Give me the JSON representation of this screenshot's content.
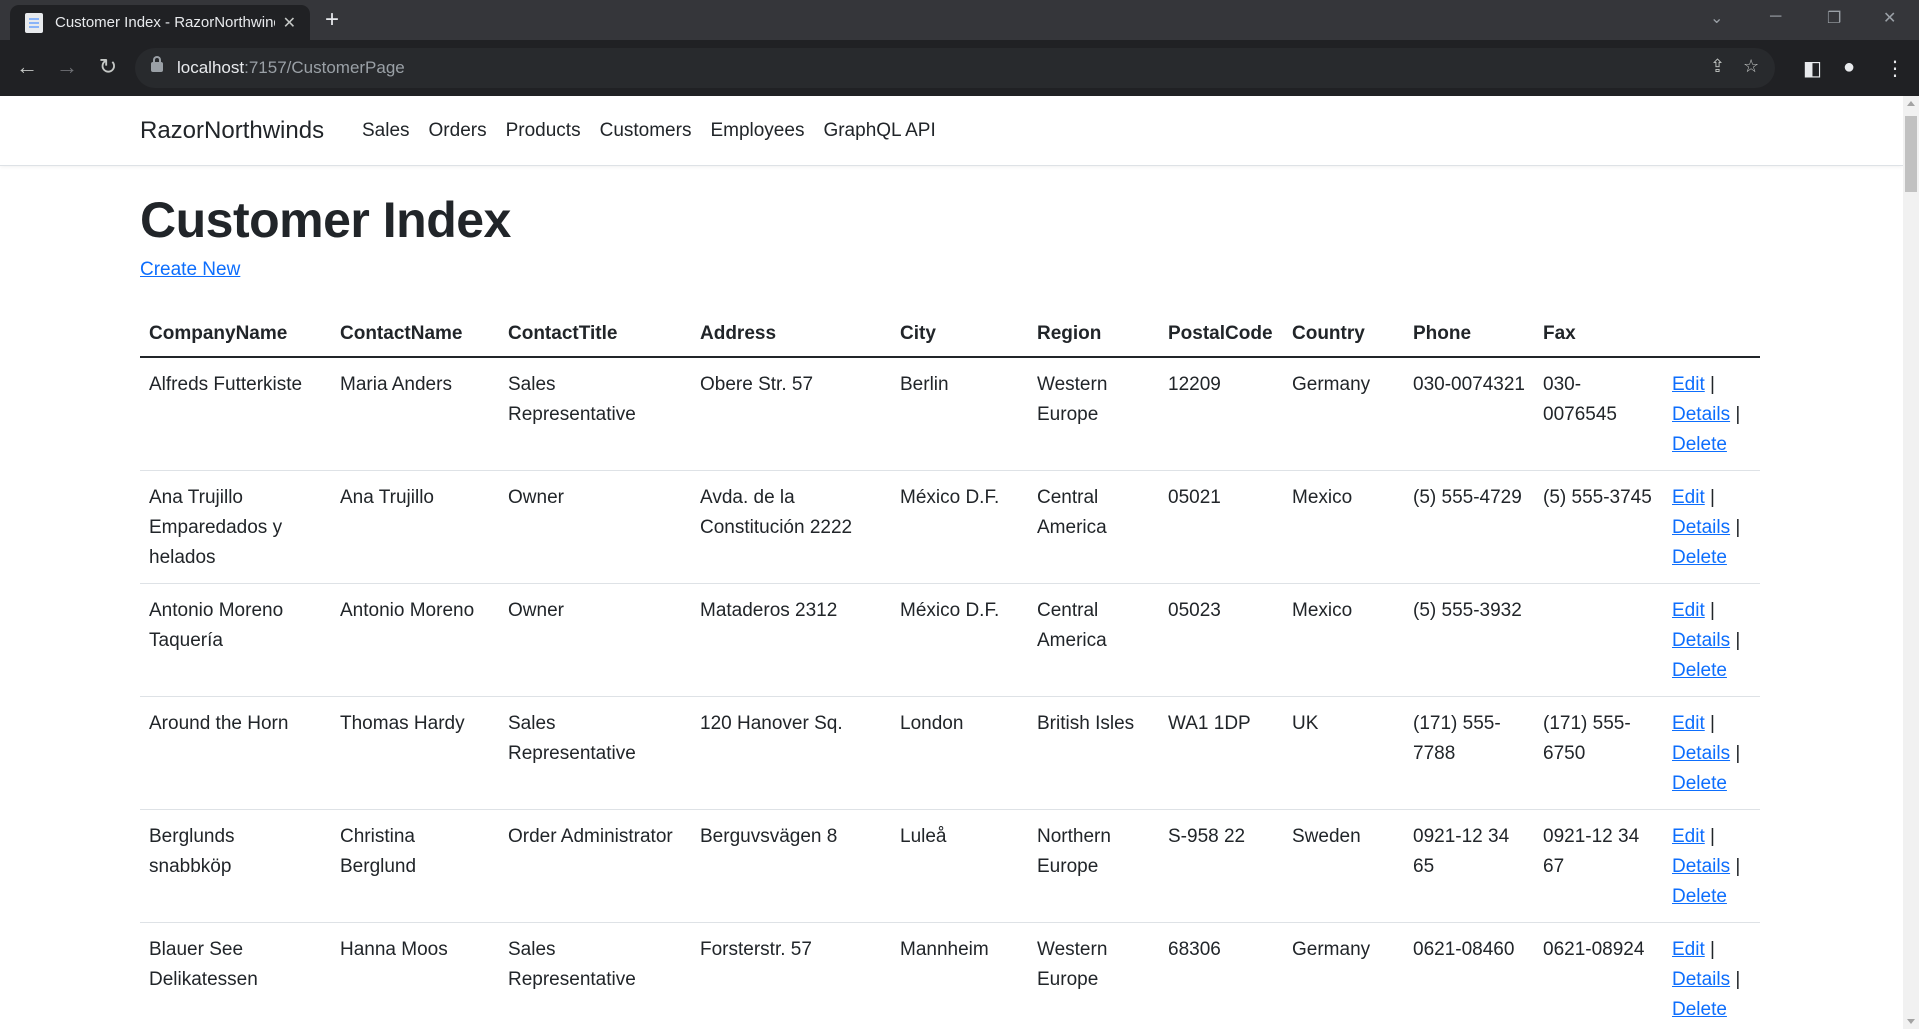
{
  "browser": {
    "tab_title": "Customer Index - RazorNorthwinds",
    "url_host": "localhost",
    "url_rest": ":7157/CustomerPage",
    "new_tab_glyph": "+",
    "close_glyph": "✕"
  },
  "navbar": {
    "brand": "RazorNorthwinds",
    "links": [
      "Sales",
      "Orders",
      "Products",
      "Customers",
      "Employees",
      "GraphQL API"
    ]
  },
  "main": {
    "title": "Customer Index",
    "create_link": "Create New",
    "columns": [
      "CompanyName",
      "ContactName",
      "ContactTitle",
      "Address",
      "City",
      "Region",
      "PostalCode",
      "Country",
      "Phone",
      "Fax"
    ],
    "actions": {
      "edit": "Edit",
      "details": "Details",
      "delete": "Delete",
      "separator": "|"
    },
    "rows": [
      [
        "Alfreds Futterkiste",
        "Maria Anders",
        "Sales Representative",
        "Obere Str. 57",
        "Berlin",
        "Western Europe",
        "12209",
        "Germany",
        "030-0074321",
        "030-0076545"
      ],
      [
        "Ana Trujillo Emparedados y helados",
        "Ana Trujillo",
        "Owner",
        "Avda. de la Constitución 2222",
        "México D.F.",
        "Central America",
        "05021",
        "Mexico",
        "(5) 555-4729",
        "(5) 555-3745"
      ],
      [
        "Antonio Moreno Taquería",
        "Antonio Moreno",
        "Owner",
        "Mataderos 2312",
        "México D.F.",
        "Central America",
        "05023",
        "Mexico",
        "(5) 555-3932",
        ""
      ],
      [
        "Around the Horn",
        "Thomas Hardy",
        "Sales Representative",
        "120 Hanover Sq.",
        "London",
        "British Isles",
        "WA1 1DP",
        "UK",
        "(171) 555-7788",
        "(171) 555-6750"
      ],
      [
        "Berglunds snabbköp",
        "Christina Berglund",
        "Order Administrator",
        "Berguvsvägen 8",
        "Luleå",
        "Northern Europe",
        "S-958 22",
        "Sweden",
        "0921-12 34 65",
        "0921-12 34 67"
      ],
      [
        "Blauer See Delikatessen",
        "Hanna Moos",
        "Sales Representative",
        "Forsterstr. 57",
        "Mannheim",
        "Western Europe",
        "68306",
        "Germany",
        "0621-08460",
        "0621-08924"
      ]
    ]
  },
  "colors": {
    "link": "#0d6efd",
    "text": "#212529",
    "chrome_dark": "#202124",
    "chrome_titlebar": "#35363a"
  }
}
